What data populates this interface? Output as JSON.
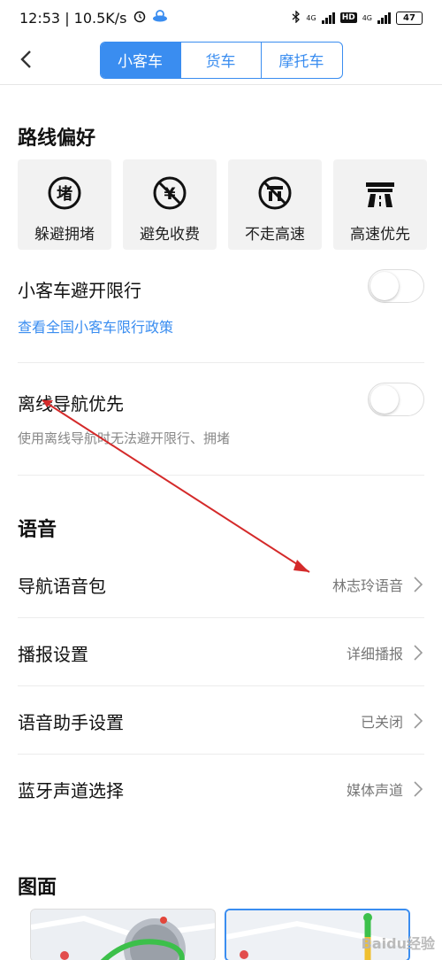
{
  "status": {
    "time": "12:53 | 10.5K/s",
    "battery": "47",
    "network": "4G"
  },
  "tabs": [
    {
      "label": "小客车"
    },
    {
      "label": "货车"
    },
    {
      "label": "摩托车"
    }
  ],
  "route_pref": {
    "title": "路线偏好",
    "options": [
      {
        "label": "躲避拥堵",
        "icon": "avoid-congestion-icon",
        "glyph": "堵"
      },
      {
        "label": "避免收费",
        "icon": "avoid-toll-icon",
        "glyph": "¥"
      },
      {
        "label": "不走高速",
        "icon": "no-highway-icon"
      },
      {
        "label": "高速优先",
        "icon": "highway-first-icon"
      }
    ]
  },
  "restriction": {
    "title": "小客车避开限行",
    "link": "查看全国小客车限行政策",
    "enabled": false
  },
  "offline": {
    "title": "离线导航优先",
    "sub": "使用离线导航时无法避开限行、拥堵",
    "enabled": false
  },
  "voice": {
    "title": "语音",
    "items": [
      {
        "title": "导航语音包",
        "value": "林志玲语音"
      },
      {
        "title": "播报设置",
        "value": "详细播报"
      },
      {
        "title": "语音助手设置",
        "value": "已关闭"
      },
      {
        "title": "蓝牙声道选择",
        "value": "媒体声道"
      }
    ]
  },
  "map": {
    "title": "图面"
  },
  "watermark": "Baidu经验",
  "colors": {
    "accent": "#3a8df0",
    "annotation": "#d42a2a"
  }
}
